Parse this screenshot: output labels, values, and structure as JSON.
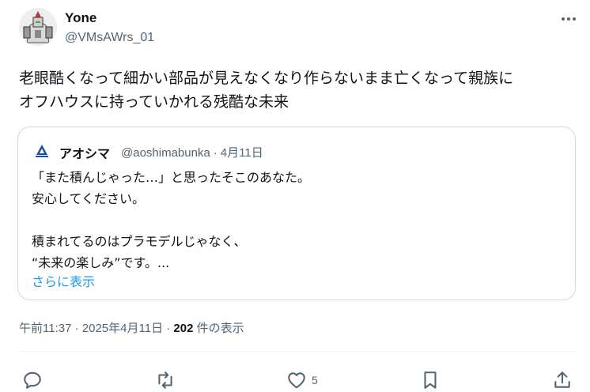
{
  "author": {
    "name": "Yone",
    "handle": "@VMsAWrs_01"
  },
  "post": {
    "text_line1": "老眼酷くなって細かい部品が見えなくなり作らないまま亡くなって親族に",
    "text_line2": "オフハウスに持っていかれる残酷な未来"
  },
  "quote": {
    "name": "アオシマ",
    "handle": "@aoshimabunka",
    "separator": "·",
    "date": "4月11日",
    "body_lines": [
      "「また積んじゃった…」と思ったそこのあなた。",
      "安心してください。",
      "",
      "積まれてるのはプラモデルじゃなく、",
      "“未来の楽しみ”です。..."
    ],
    "show_more": "さらに表示"
  },
  "meta": {
    "time": "午前11:37",
    "sep1": "·",
    "date": "2025年4月11日",
    "sep2": "·",
    "views_count": "202",
    "views_label": "件の表示"
  },
  "actions": {
    "like_count": "5"
  },
  "colors": {
    "text": "#0f1419",
    "secondary": "#536471",
    "link": "#1d9bf0",
    "border": "#cfd9de"
  },
  "icons": [
    "more-icon",
    "reply-icon",
    "retweet-icon",
    "like-icon",
    "bookmark-icon",
    "share-icon",
    "aoshima-logo-icon"
  ]
}
